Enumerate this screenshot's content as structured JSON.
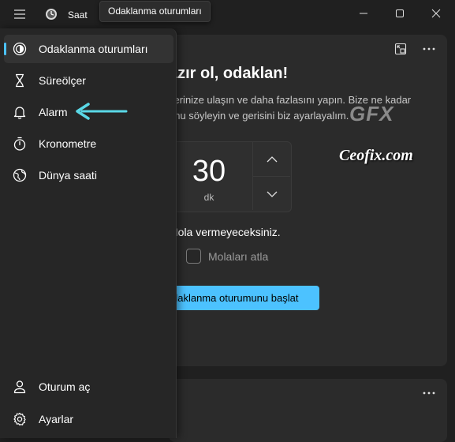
{
  "window": {
    "app_title": "Saat",
    "tooltip": "Odaklanma oturumları"
  },
  "nav": {
    "items": [
      {
        "label": "Odaklanma oturumları",
        "icon": "focus-icon",
        "selected": true
      },
      {
        "label": "Süreölçer",
        "icon": "hourglass-icon"
      },
      {
        "label": "Alarm",
        "icon": "bell-icon"
      },
      {
        "label": "Kronometre",
        "icon": "stopwatch-icon"
      },
      {
        "label": "Dünya saati",
        "icon": "globe-icon"
      }
    ],
    "footer": [
      {
        "label": "Oturum aç",
        "icon": "person-icon"
      },
      {
        "label": "Ayarlar",
        "icon": "gear-icon"
      }
    ]
  },
  "focus": {
    "heading": "azır ol, odaklan!",
    "desc_line1": "flerinize ulaşın ve daha fazlasını yapın. Bize ne kadar",
    "desc_line2": "unu söyleyin ve gerisini biz ayarlayalım.",
    "time_value": "30",
    "time_unit": "dk",
    "break_info": "Mola vermeyeceksiniz.",
    "skip_breaks_label": "Molaları atla",
    "skip_breaks_checked": false,
    "start_button": "daklanma oturumunu başlat"
  },
  "watermark": {
    "logo": "GFX",
    "text": "Ceofix.com"
  },
  "colors": {
    "accent": "#4cc2ff",
    "arrow": "#5ad8e6",
    "background": "#202020",
    "card": "#2b2b2b",
    "nav": "#262626"
  }
}
